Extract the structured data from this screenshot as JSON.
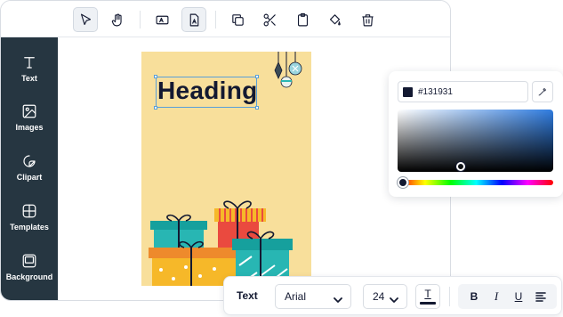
{
  "toolbar": {
    "tools": [
      {
        "icon": "pointer-icon",
        "active": true
      },
      {
        "icon": "hand-icon",
        "active": false
      },
      {
        "icon": "text-box-icon",
        "active": false
      },
      {
        "icon": "text-file-icon",
        "active": true
      },
      {
        "icon": "duplicate-icon",
        "active": false
      },
      {
        "icon": "scissors-icon",
        "active": false
      },
      {
        "icon": "clipboard-icon",
        "active": false
      },
      {
        "icon": "fill-bucket-icon",
        "active": false
      },
      {
        "icon": "trash-icon",
        "active": false
      }
    ]
  },
  "sidebar": {
    "items": [
      {
        "label": "Text",
        "icon": "text-icon"
      },
      {
        "label": "Images",
        "icon": "image-icon"
      },
      {
        "label": "Clipart",
        "icon": "sticker-icon"
      },
      {
        "label": "Templates",
        "icon": "templates-icon"
      },
      {
        "label": "Background",
        "icon": "background-icon"
      }
    ]
  },
  "canvas": {
    "heading": "Heading",
    "card_color": "#f8df9b"
  },
  "color_picker": {
    "hex": "#131931",
    "accent_hue": "#2f7ce0"
  },
  "text_toolbar": {
    "label": "Text",
    "font": "Arial",
    "size": "24",
    "color_button_glyph": "T",
    "bold_glyph": "B",
    "italic_glyph": "I",
    "underline_glyph": "U",
    "text_color": "#131931"
  },
  "colors": {
    "sidebar_bg": "#263641",
    "selection": "#5a9fd8"
  }
}
